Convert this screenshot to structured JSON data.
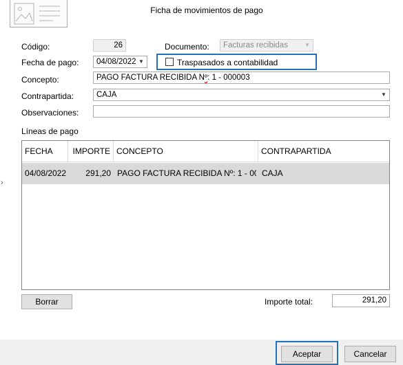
{
  "window": {
    "title": "Ficha de movimientos de pago"
  },
  "form": {
    "codigo_label": "Código:",
    "codigo_value": "26",
    "documento_label": "Documento:",
    "documento_value": "Facturas recibidas",
    "fecha_label": "Fecha de pago:",
    "fecha_value": "04/08/2022",
    "traspasados_label": "Traspasados a contabilidad",
    "traspasados_checked": false,
    "concepto_label": "Concepto:",
    "concepto_value_a": "PAGO FACTURA RECIBIDA N",
    "concepto_value_b": "º",
    "concepto_value_c": ": 1 - 000003",
    "contrapartida_label": "Contrapartida:",
    "contrapartida_value": "CAJA",
    "observaciones_label": "Observaciones:",
    "observaciones_value": ""
  },
  "lines": {
    "section_label": "Líneas de pago",
    "columns": [
      "FECHA",
      "IMPORTE",
      "CONCEPTO",
      "CONTRAPARTIDA"
    ],
    "rows": [
      {
        "fecha": "04/08/2022",
        "importe": "291,20",
        "concepto": "PAGO FACTURA RECIBIDA Nº: 1 - 00...",
        "contrapartida": "CAJA"
      }
    ]
  },
  "actions": {
    "borrar": "Borrar",
    "importe_total_label": "Importe total:",
    "importe_total_value": "291,20",
    "aceptar": "Aceptar",
    "cancelar": "Cancelar"
  },
  "icons": {
    "dropdown": "chevron-down-icon",
    "side_arrow": "chevron-right-icon",
    "header": "document-image-icon"
  },
  "colors": {
    "focus": "#1e73be",
    "selected_row": "#d9d9d9",
    "footer": "#f0f0f0"
  }
}
